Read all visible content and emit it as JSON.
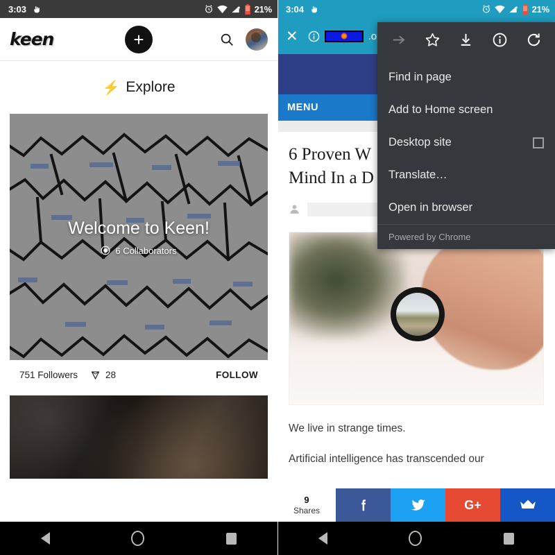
{
  "left": {
    "status": {
      "time": "3:03",
      "battery_pct": "21%",
      "icons": [
        "touch-indicator-icon",
        "alarm-icon",
        "wifi-icon",
        "signal-icon",
        "battery-icon"
      ]
    },
    "header": {
      "logo": "keen",
      "add_label": "+",
      "search_icon": "search-icon",
      "avatar": "user-avatar"
    },
    "explore": {
      "emoji": "⚡",
      "label": "Explore"
    },
    "card": {
      "title": "Welcome to Keen!",
      "collaborators": "6 Collaborators",
      "followers": "751 Followers",
      "gems": "28",
      "follow_label": "FOLLOW"
    },
    "nav": {
      "back": "back-icon",
      "home": "home-icon",
      "recents": "recents-icon"
    }
  },
  "right": {
    "status": {
      "time": "3:04",
      "battery_pct": "21%"
    },
    "toolbar": {
      "close_label": "✕",
      "info_icon": "page-info-icon",
      "url_suffix": ".om",
      "url_redacted": true
    },
    "site": {
      "menu_label": "MENU"
    },
    "article": {
      "title_line1": "6 Proven W",
      "title_line2": "Mind In a D",
      "paragraph1": "We live in strange times.",
      "paragraph2": "Artificial intelligence has transcended our"
    },
    "share": {
      "count": "9",
      "count_label": "Shares",
      "buttons": [
        {
          "name": "facebook",
          "glyph": "f",
          "color": "#3b5998"
        },
        {
          "name": "twitter",
          "glyph": "▸",
          "color": "#1da1f2"
        },
        {
          "name": "googleplus",
          "glyph": "G+",
          "color": "#e64a33"
        },
        {
          "name": "crown",
          "glyph": "♛",
          "color": "#1657c8"
        }
      ]
    },
    "menu": {
      "icons": [
        "forward-arrow-icon",
        "bookmark-star-icon",
        "download-icon",
        "page-info-icon",
        "reload-icon"
      ],
      "items": [
        {
          "label": "Find in page",
          "checkbox": false
        },
        {
          "label": "Add to Home screen",
          "checkbox": false
        },
        {
          "label": "Desktop site",
          "checkbox": true
        },
        {
          "label": "Translate…",
          "checkbox": false
        },
        {
          "label": "Open in browser",
          "checkbox": false
        }
      ],
      "footer": "Powered by Chrome"
    },
    "nav": {
      "back": "back-icon",
      "home": "home-icon",
      "recents": "recents-icon"
    }
  },
  "colors": {
    "cct_accent": "#1f9cc0",
    "site_banner": "#2f3f86",
    "menu_strip": "#1b79c9",
    "menu_bg": "#35383c"
  }
}
